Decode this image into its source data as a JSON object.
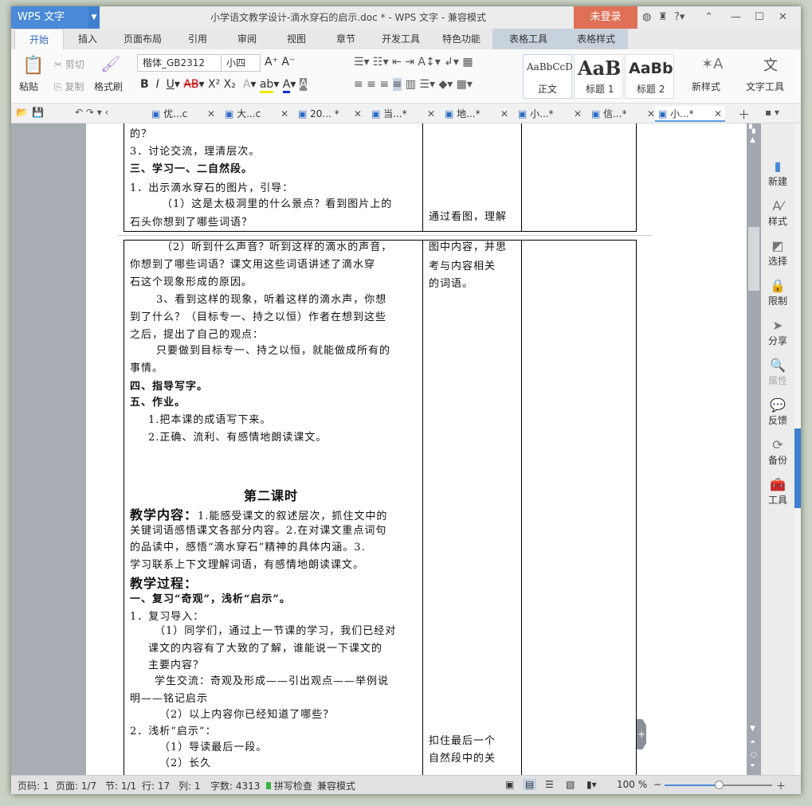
{
  "app": {
    "name": "WPS 文字",
    "title": "小学语文教学设计-滴水穿石的启示.doc * - WPS 文字 - 兼容模式",
    "login": "未登录"
  },
  "colors": {
    "brand": "#4a8ad8",
    "login": "#e07055",
    "accent_tab": "#2c6cc4"
  },
  "tabs": [
    "开始",
    "插入",
    "页面布局",
    "引用",
    "审阅",
    "视图",
    "章节",
    "开发工具",
    "特色功能",
    "表格工具",
    "表格样式"
  ],
  "ribbon": {
    "paste": "粘贴",
    "cut": "剪切",
    "copy": "复制",
    "format_painter": "格式刷",
    "font": "楷体_GB2312",
    "size": "小四",
    "styles": [
      {
        "preview": "AaBbCcD",
        "label": "正文"
      },
      {
        "preview": "AaB",
        "label": "标题 1"
      },
      {
        "preview": "AaBb",
        "label": "标题 2"
      }
    ],
    "new_style": "新样式",
    "text_tools": "文字工具"
  },
  "doctabs": [
    "优...c",
    "大...c",
    "20... *",
    "当...*",
    "地...*",
    "小...*",
    "信...*",
    "小...*"
  ],
  "doc": {
    "seg1_left": [
      "的？",
      "3．讨论交流，理清层次。",
      "三、学习一、二自然段。",
      "1．出示滴水穿石的图片，引导：",
      "（1）这是太极洞里的什么景点？看到图片上的",
      "石头你想到了哪些词语？"
    ],
    "seg1_right": [
      "通过看图，理解"
    ],
    "seg2_left": [
      "（2）听到什么声音？听到这样的滴水的声音，",
      "你想到了哪些词语？课文用这些词语讲述了滴水穿",
      "石这个现象形成的原因。",
      "3、看到这样的现象，听着这样的滴水声，你想",
      "到了什么？（目标专一、持之以恒）作者在想到这些",
      "之后，提出了自己的观点：",
      "只要做到目标专一、持之以恒，就能做成所有的",
      "事情。",
      "四、指导写字。",
      "五、作业。",
      "1.把本课的成语写下来。",
      "2.正确、流利、有感情地朗读课文。"
    ],
    "lesson2_title": "第二课时",
    "content_label": "教学内容：",
    "content_lines": [
      "1.能感受课文的叙述层次，抓住文中的",
      "关键词语感悟课文各部分内容。2.在对课文重点词句",
      "的品读中，感悟“滴水穿石”精神的具体内涵。3.",
      "学习联系上下文理解词语，有感情地朗读课文。"
    ],
    "process_label": "教学过程：",
    "process_lines": [
      "一、复习“奇观”，浅析“启示”。",
      "1．复习导入：",
      "（1）同学们，通过上一节课的学习，我们已经对",
      "课文的内容有了大致的了解，谁能说一下课文的",
      "主要内容？",
      "学生交流：奇观及形成——引出观点——举例说",
      "明——铭记启示",
      "（2）以上内容你已经知道了哪些？",
      "2．浅析“启示”：",
      "（1）导读最后一段。",
      "（2）长久"
    ],
    "seg2_right": [
      "图中内容，并思",
      "考与内容相关",
      "的词语。"
    ],
    "seg2_right_bottom": [
      "扣住最后一个",
      "自然段中的关"
    ]
  },
  "sidepanel": [
    {
      "icon": "new-doc-icon",
      "label": "新建"
    },
    {
      "icon": "style-icon",
      "label": "样式"
    },
    {
      "icon": "select-icon",
      "label": "选择"
    },
    {
      "icon": "lock-icon",
      "label": "限制"
    },
    {
      "icon": "share-icon",
      "label": "分享"
    },
    {
      "icon": "properties-icon",
      "label": "属性"
    },
    {
      "icon": "feedback-icon",
      "label": "反馈"
    },
    {
      "icon": "backup-icon",
      "label": "备份"
    },
    {
      "icon": "toolbox-icon",
      "label": "工具"
    }
  ],
  "status": {
    "page_num": "页码: 1",
    "pages": "页面: 1/7",
    "section": "节: 1/1",
    "row": "行: 17",
    "col": "列: 1",
    "words": "字数: 4313",
    "spell": "拼写检查",
    "mode": "兼容模式",
    "zoom": "100 %",
    "zoom_level": 0.5
  }
}
